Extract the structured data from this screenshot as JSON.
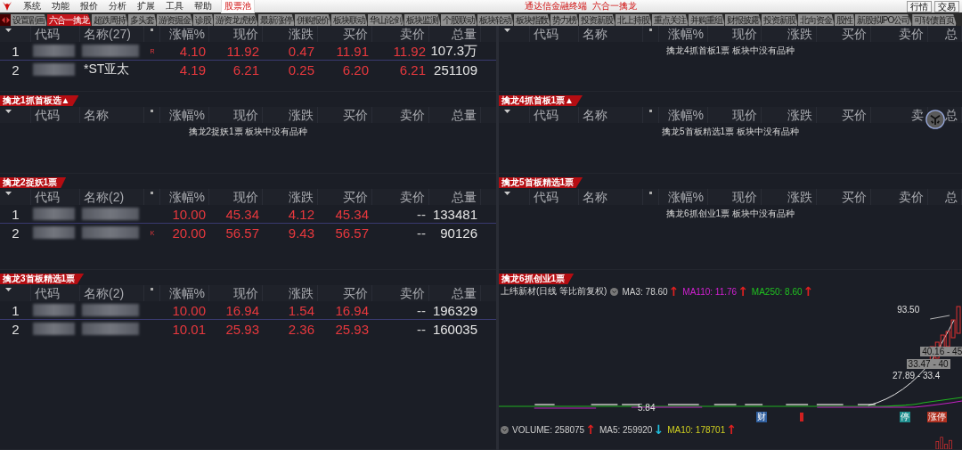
{
  "menu": {
    "items": [
      {
        "label": "系统",
        "selected": false
      },
      {
        "label": "功能",
        "selected": false
      },
      {
        "label": "报价",
        "selected": false
      },
      {
        "label": "分析",
        "selected": false
      },
      {
        "label": "扩展",
        "selected": false
      },
      {
        "label": "工具",
        "selected": false
      },
      {
        "label": "帮助",
        "selected": false
      },
      {
        "label": "股票池",
        "selected": true
      }
    ],
    "title": "通达信金融终端  六合一擒龙",
    "buttons": [
      "行情",
      "交易"
    ]
  },
  "tabs": [
    {
      "label": "设置剧画",
      "selected": false
    },
    {
      "label": "六合一擒龙",
      "selected": true
    },
    {
      "label": "超跌周持",
      "selected": false
    },
    {
      "label": "多头套",
      "selected": false
    },
    {
      "label": "游资掘金",
      "selected": false
    },
    {
      "label": "诊股",
      "selected": false
    },
    {
      "label": "游资龙虎榜",
      "selected": false
    },
    {
      "label": "最新涨停",
      "selected": false
    },
    {
      "label": "併购报价",
      "selected": false
    },
    {
      "label": "板块联动",
      "selected": false
    },
    {
      "label": "华山论剑",
      "selected": false
    },
    {
      "label": "板块监测",
      "selected": false
    },
    {
      "label": "个股联动",
      "selected": false
    },
    {
      "label": "板块轮动",
      "selected": false
    },
    {
      "label": "板块指数",
      "selected": false
    },
    {
      "label": "势力榜",
      "selected": false
    },
    {
      "label": "投资新股",
      "selected": false
    },
    {
      "label": "北上持股",
      "selected": false
    },
    {
      "label": "重点关注",
      "selected": false
    },
    {
      "label": "并购重组",
      "selected": false
    },
    {
      "label": "财报披露",
      "selected": false
    },
    {
      "label": "投资新股",
      "selected": false
    },
    {
      "label": "北向资金",
      "selected": false
    },
    {
      "label": "股性",
      "selected": false
    },
    {
      "label": "新股拟IPO公司",
      "selected": false
    },
    {
      "label": "可转债首页",
      "selected": false
    }
  ],
  "left_panels": [
    {
      "columns": [
        "代码",
        "名称(27)",
        "涨幅%",
        "现价",
        "涨跌",
        "买价",
        "卖价",
        "总量"
      ],
      "rows": [
        {
          "index": "1",
          "selected": true,
          "flag": "R",
          "values": [
            "4.10",
            "11.92",
            "0.47",
            "11.91",
            "11.92"
          ],
          "volume": "107.3万"
        },
        {
          "index": "2",
          "selected": false,
          "name": "*ST亚太",
          "values": [
            "4.19",
            "6.21",
            "0.25",
            "6.20",
            "6.21"
          ],
          "volume": "251109"
        }
      ]
    },
    {
      "title": "擒龙1抓首板选▲",
      "columns": [
        "代码",
        "名称",
        "涨幅%",
        "现价",
        "涨跌",
        "买价",
        "卖价",
        "总量"
      ],
      "empty_message": "擒龙2捉妖1票 板块中没有品种"
    },
    {
      "title": "擒龙2捉妖1票",
      "columns": [
        "代码",
        "名称(2)",
        "涨幅%",
        "现价",
        "涨跌",
        "买价",
        "卖价",
        "总量"
      ],
      "rows": [
        {
          "index": "1",
          "selected": true,
          "values": [
            "10.00",
            "45.34",
            "4.12",
            "45.34",
            "--"
          ],
          "volume": "133481"
        },
        {
          "index": "2",
          "selected": false,
          "flag": "K",
          "values": [
            "20.00",
            "56.57",
            "9.43",
            "56.57",
            "--"
          ],
          "volume": "90126"
        }
      ]
    },
    {
      "title": "擒龙3首板精选1票",
      "columns": [
        "代码",
        "名称(2)",
        "涨幅%",
        "现价",
        "涨跌",
        "买价",
        "卖价",
        "总量"
      ],
      "rows": [
        {
          "index": "1",
          "selected": true,
          "values": [
            "10.00",
            "16.94",
            "1.54",
            "16.94",
            "--"
          ],
          "volume": "196329"
        },
        {
          "index": "2",
          "selected": false,
          "values": [
            "10.01",
            "25.93",
            "2.36",
            "25.93",
            "--"
          ],
          "volume": "160035"
        }
      ]
    }
  ],
  "right_panels": [
    {
      "columns": [
        "代码",
        "名称",
        "涨幅%",
        "现价",
        "涨跌",
        "买价",
        "卖价",
        "总"
      ],
      "empty_message": "擒龙4抓首板1票 板块中没有品种"
    },
    {
      "title": "擒龙4抓首板1票▲",
      "columns": [
        "代码",
        "名称",
        "涨幅%",
        "现价",
        "涨跌",
        "买价",
        "卖",
        "总"
      ],
      "empty_message": "擒龙5首板精选1票 板块中没有品种"
    },
    {
      "title": "擒龙5首板精选1票",
      "columns": [
        "代码",
        "名称",
        "涨幅%",
        "现价",
        "涨跌",
        "买价",
        "卖价",
        "总"
      ],
      "empty_message": "擒龙6抓创业1票 板块中没有品种"
    }
  ],
  "chart_panel": {
    "title": "擒龙6抓创业1票",
    "stock": "上纬新材(日线 等比前复权)",
    "legend": [
      {
        "text": "MA3: 78.60",
        "color": "#d0d0d0",
        "arrow": {
          "text": "↑",
          "color": "#e02020"
        }
      },
      {
        "text": "MA110: 11.76",
        "color": "#d020d0",
        "arrow": {
          "text": "↑",
          "color": "#e02020"
        }
      },
      {
        "text": "MA250: 8.60",
        "color": "#20c020",
        "arrow": {
          "text": "↑",
          "color": "#e02020"
        }
      }
    ],
    "price_labels": [
      "93.50",
      "40.16 - 45",
      "33.47 - 40",
      "27.89 - 33.4",
      "5.84"
    ],
    "markers": [
      {
        "text": "财",
        "color": "#2f5f9f"
      },
      {
        "text": "停",
        "color": "#1f8f8f"
      },
      {
        "text": "涨停",
        "color": "#b03020"
      }
    ],
    "volume_legend": [
      {
        "text": "VOLUME: 258075",
        "color": "#d0d0d0",
        "arrow": {
          "text": "↑",
          "color": "#e02020"
        }
      },
      {
        "text": "MA5: 259920",
        "color": "#d0d0d0",
        "arrow": {
          "text": "↓",
          "color": "#20c0e0"
        }
      },
      {
        "text": "MA10: 178701",
        "color": "#d0d020",
        "arrow": {
          "text": "↑",
          "color": "#e02020"
        }
      }
    ]
  }
}
